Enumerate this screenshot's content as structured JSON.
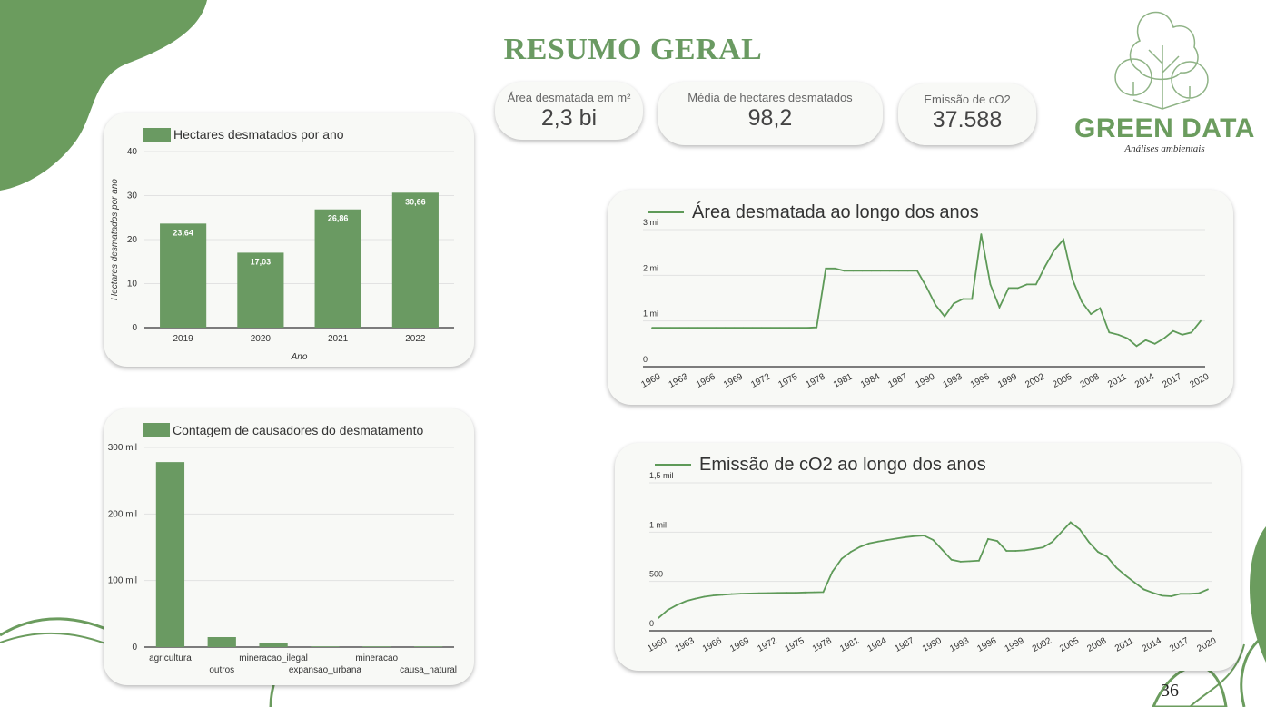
{
  "page": {
    "title": "RESUMO GERAL",
    "page_number": "36"
  },
  "logo": {
    "name": "GREEN DATA",
    "tagline": "Análises ambientais"
  },
  "kpis": [
    {
      "label": "Área desmatada em m²",
      "value": "2,3 bi"
    },
    {
      "label": "Média de hectares desmatados",
      "value": "98,2"
    },
    {
      "label": "Emissão de cO2",
      "value": "37.588"
    }
  ],
  "colors": {
    "accent": "#6a9a62",
    "line": "#5e9a58",
    "decor": "#6b9c5e"
  },
  "chart_data": [
    {
      "id": "hectares",
      "type": "bar",
      "legend": "Hectares desmatados por ano",
      "xlabel": "Ano",
      "ylabel": "Hectares desmatados por ano",
      "categories": [
        "2019",
        "2020",
        "2021",
        "2022"
      ],
      "values": [
        23.64,
        17.03,
        26.86,
        30.66
      ],
      "value_labels": [
        "23,64",
        "17,03",
        "26,86",
        "30,66"
      ],
      "ylim": [
        0,
        40
      ],
      "yticks": [
        0,
        10,
        20,
        30,
        40
      ],
      "ytick_labels": [
        "0",
        "10",
        "20",
        "30",
        "40"
      ],
      "grid": true
    },
    {
      "id": "causadores",
      "type": "bar",
      "legend": "Contagem de causadores do desmatamento",
      "categories": [
        "agricultura",
        "outros",
        "mineracao_ilegal",
        "expansao_urbana",
        "mineracao",
        "causa_natural"
      ],
      "values": [
        278000,
        15000,
        6000,
        1000,
        500,
        100
      ],
      "ylim": [
        0,
        300000
      ],
      "yticks": [
        0,
        100000,
        200000,
        300000
      ],
      "ytick_labels": [
        "0",
        "100 mil",
        "200 mil",
        "300 mil"
      ],
      "grid": true
    },
    {
      "id": "area",
      "type": "line",
      "legend": "Área desmatada ao longo dos anos",
      "x": [
        1960,
        1961,
        1962,
        1963,
        1964,
        1965,
        1966,
        1967,
        1968,
        1969,
        1970,
        1971,
        1972,
        1973,
        1974,
        1975,
        1976,
        1977,
        1978,
        1979,
        1980,
        1981,
        1982,
        1983,
        1984,
        1985,
        1986,
        1987,
        1988,
        1989,
        1990,
        1991,
        1992,
        1993,
        1994,
        1995,
        1996,
        1997,
        1998,
        1999,
        2000,
        2001,
        2002,
        2003,
        2004,
        2005,
        2006,
        2007,
        2008,
        2009,
        2010,
        2011,
        2012,
        2013,
        2014,
        2015,
        2016,
        2017,
        2018,
        2019,
        2020
      ],
      "values": [
        0.85,
        0.85,
        0.85,
        0.85,
        0.85,
        0.85,
        0.85,
        0.85,
        0.85,
        0.85,
        0.85,
        0.85,
        0.85,
        0.85,
        0.85,
        0.85,
        0.85,
        0.85,
        0.86,
        2.15,
        2.15,
        2.1,
        2.1,
        2.1,
        2.1,
        2.1,
        2.1,
        2.1,
        2.1,
        2.1,
        1.75,
        1.35,
        1.1,
        1.38,
        1.48,
        1.48,
        2.9,
        1.8,
        1.3,
        1.72,
        1.72,
        1.8,
        1.8,
        2.2,
        2.55,
        2.78,
        1.9,
        1.42,
        1.15,
        1.28,
        0.75,
        0.7,
        0.62,
        0.45,
        0.58,
        0.5,
        0.62,
        0.78,
        0.7,
        0.75,
        1.0,
        1.1
      ],
      "ylim": [
        0,
        3
      ],
      "yticks": [
        0,
        1,
        2,
        3
      ],
      "ytick_labels": [
        "0",
        "1 mi",
        "2 mi",
        "3 mi"
      ],
      "xticks": [
        "1960",
        "1963",
        "1966",
        "1969",
        "1972",
        "1975",
        "1978",
        "1981",
        "1984",
        "1987",
        "1990",
        "1993",
        "1996",
        "1999",
        "2002",
        "2005",
        "2008",
        "2011",
        "2014",
        "2017",
        "2020"
      ],
      "grid": true
    },
    {
      "id": "emissao",
      "type": "line",
      "legend": "Emissão de cO2 ao longo dos anos",
      "x": [
        1960,
        1961,
        1962,
        1963,
        1964,
        1965,
        1966,
        1967,
        1968,
        1969,
        1970,
        1971,
        1972,
        1973,
        1974,
        1975,
        1976,
        1977,
        1978,
        1979,
        1980,
        1981,
        1982,
        1983,
        1984,
        1985,
        1986,
        1987,
        1988,
        1989,
        1990,
        1991,
        1992,
        1993,
        1994,
        1995,
        1996,
        1997,
        1998,
        1999,
        2000,
        2001,
        2002,
        2003,
        2004,
        2005,
        2006,
        2007,
        2008,
        2009,
        2010,
        2011,
        2012,
        2013,
        2014,
        2015,
        2016,
        2017,
        2018,
        2019,
        2020
      ],
      "values": [
        130,
        210,
        260,
        300,
        325,
        345,
        358,
        365,
        372,
        376,
        378,
        380,
        382,
        384,
        385,
        386,
        388,
        390,
        392,
        600,
        730,
        800,
        850,
        885,
        905,
        920,
        935,
        950,
        960,
        965,
        920,
        820,
        720,
        700,
        705,
        710,
        930,
        910,
        810,
        810,
        815,
        830,
        845,
        900,
        1000,
        1100,
        1030,
        900,
        800,
        750,
        640,
        560,
        490,
        420,
        385,
        355,
        350,
        375,
        375,
        380,
        420,
        470
      ],
      "ylim": [
        0,
        1500
      ],
      "yticks": [
        0,
        500,
        1000,
        1500
      ],
      "ytick_labels": [
        "0",
        "500",
        "1 mil",
        "1,5 mil"
      ],
      "xticks": [
        "1960",
        "1963",
        "1966",
        "1969",
        "1972",
        "1975",
        "1978",
        "1981",
        "1984",
        "1987",
        "1990",
        "1993",
        "1996",
        "1999",
        "2002",
        "2005",
        "2008",
        "2011",
        "2014",
        "2017",
        "2020"
      ],
      "grid": true
    }
  ]
}
